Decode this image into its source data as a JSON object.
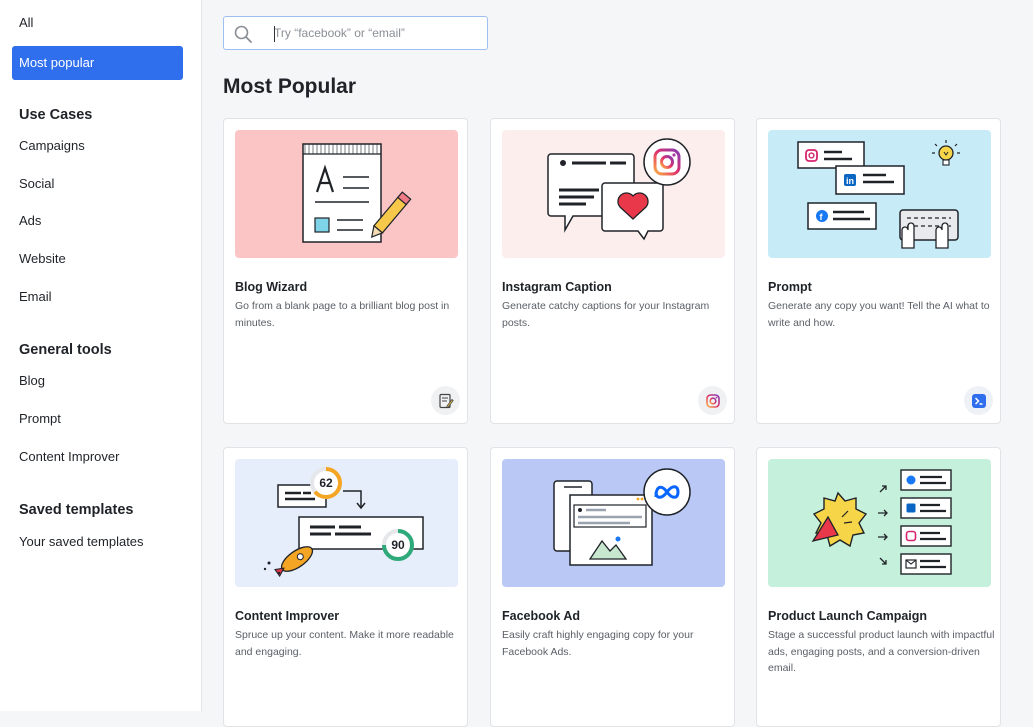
{
  "sidebar": {
    "items_top": [
      {
        "label": "All",
        "active": false
      },
      {
        "label": "Most popular",
        "active": true
      }
    ],
    "use_cases": {
      "heading": "Use Cases",
      "items": [
        "Campaigns",
        "Social",
        "Ads",
        "Website",
        "Email"
      ]
    },
    "general_tools": {
      "heading": "General tools",
      "items": [
        "Blog",
        "Prompt",
        "Content Improver"
      ]
    },
    "saved_templates": {
      "heading": "Saved templates",
      "items": [
        "Your saved templates"
      ]
    }
  },
  "search": {
    "placeholder": "Try “facebook” or “email”",
    "value": ""
  },
  "main": {
    "title": "Most Popular",
    "cards": [
      {
        "title": "Blog Wizard",
        "description": "Go from a blank page to a brilliant blog post in minutes.",
        "icon": "blog-icon",
        "art_bg": "#fbc5c5"
      },
      {
        "title": "Instagram Caption",
        "description": "Generate catchy captions for your Instagram posts.",
        "icon": "instagram-icon",
        "art_bg": "#fdeeee"
      },
      {
        "title": "Prompt",
        "description": "Generate any copy you want! Tell the AI what to write and how.",
        "icon": "terminal-icon",
        "art_bg": "#c8ecf7"
      },
      {
        "title": "Content Improver",
        "description": "Spruce up your content. Make it more readable and engaging.",
        "icon": "",
        "art_bg": "#e6eefb",
        "scores": [
          "62",
          "90"
        ]
      },
      {
        "title": "Facebook Ad",
        "description": "Easily craft highly engaging copy for your Facebook Ads.",
        "icon": "",
        "art_bg": "#b9c8f5"
      },
      {
        "title": "Product Launch Campaign",
        "description": "Stage a successful product launch with impactful ads, engaging posts, and a conversion-driven email.",
        "icon": "",
        "art_bg": "#c5f0dc"
      }
    ]
  },
  "colors": {
    "accent": "#2f6fed",
    "facebook": "#1877f2",
    "linkedin": "#0a66c2"
  }
}
